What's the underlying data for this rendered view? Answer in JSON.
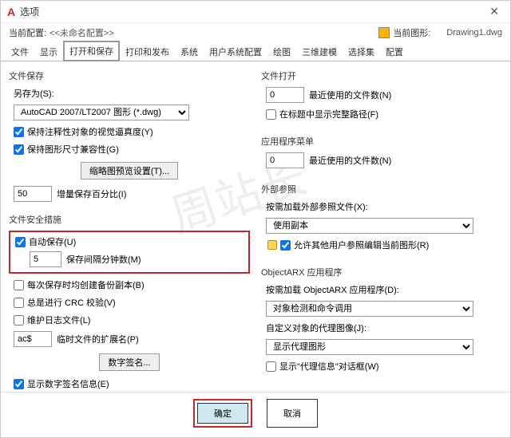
{
  "window": {
    "title": "选项"
  },
  "profile": {
    "current_label": "当前配置:",
    "current_name": "<<未命名配置>>",
    "drawing_label": "当前图形:",
    "drawing_name": "Drawing1.dwg"
  },
  "tabs": {
    "items": [
      {
        "label": "文件"
      },
      {
        "label": "显示"
      },
      {
        "label": "打开和保存"
      },
      {
        "label": "打印和发布"
      },
      {
        "label": "系统"
      },
      {
        "label": "用户系统配置"
      },
      {
        "label": "绘图"
      },
      {
        "label": "三维建模"
      },
      {
        "label": "选择集"
      },
      {
        "label": "配置"
      }
    ],
    "active_index": 2
  },
  "left": {
    "filesave_label": "文件保存",
    "saveas_label": "另存为(S):",
    "format_value": "AutoCAD 2007/LT2007 图形 (*.dwg)",
    "keep_annot": "保持注释性对象的视觉逼真度(Y)",
    "keep_size": "保持图形尺寸兼容性(G)",
    "thumb_btn": "缩略图预览设置(T)...",
    "inc_value": "50",
    "inc_label": "增量保存百分比(I)",
    "safety_label": "文件安全措施",
    "autosave": "自动保存(U)",
    "autosave_val": "5",
    "autosave_minutes": "保存间隔分钟数(M)",
    "backup": "每次保存时均创建备份副本(B)",
    "crc": "总是进行 CRC 校验(V)",
    "log": "维护日志文件(L)",
    "temp_ext_val": "ac$",
    "temp_ext_label": "临时文件的扩展名(P)",
    "sign_btn": "数字签名...",
    "show_sign": "显示数字签名信息(E)"
  },
  "right": {
    "fileopen_label": "文件打开",
    "recent_val": "0",
    "recent_label": "最近使用的文件数(N)",
    "fullpath": "在标题中显示完整路径(F)",
    "appmenu_label": "应用程序菜单",
    "appmenu_val": "0",
    "appmenu_recent": "最近使用的文件数(N)",
    "xref_label": "外部参照",
    "xref_load_label": "按需加载外部参照文件(X):",
    "xref_load_val": "使用副本",
    "allow_edit": "允许其他用户参照编辑当前图形(R)",
    "arx_label": "ObjectARX 应用程序",
    "arx_load_label": "按需加载 ObjectARX 应用程序(D):",
    "arx_load_val": "对象检测和命令调用",
    "proxy_img_label": "自定义对象的代理图像(J):",
    "proxy_img_val": "显示代理图形",
    "proxy_info": "显示\"代理信息\"对话框(W)"
  },
  "footer": {
    "ok": "确定",
    "cancel": "取消"
  },
  "watermark": "周站长"
}
